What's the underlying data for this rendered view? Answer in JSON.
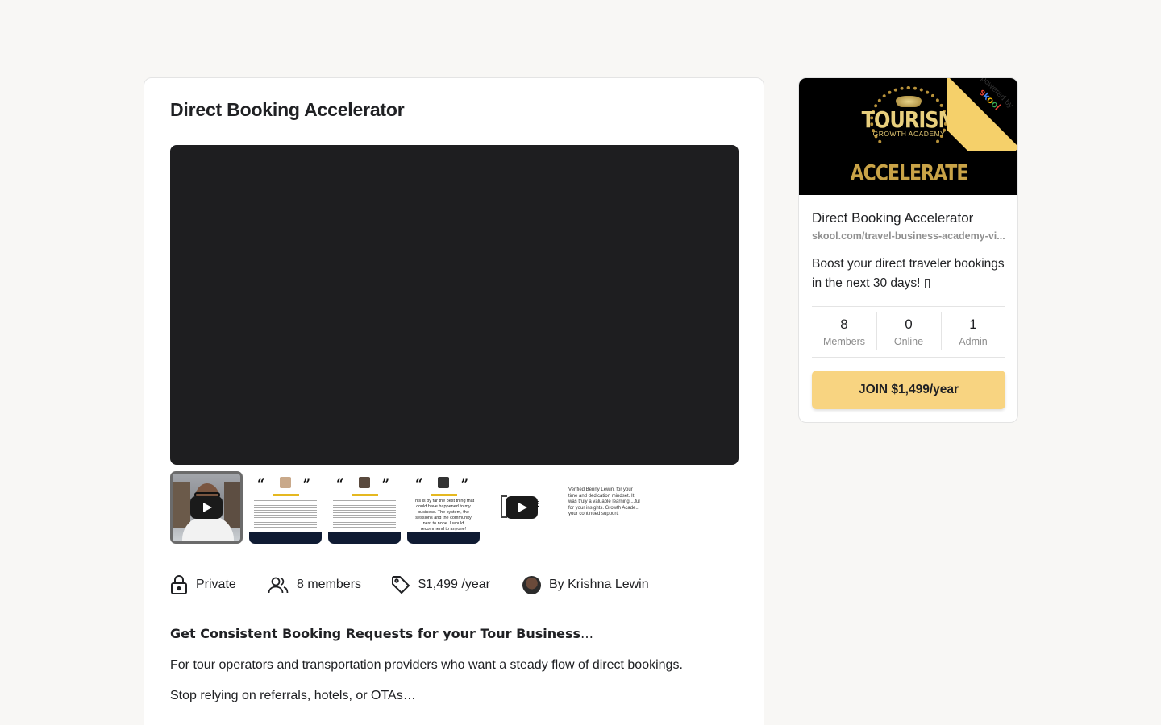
{
  "group": {
    "title": "Direct Booking Accelerator"
  },
  "gallery": {
    "thumbnails": [
      {
        "type": "video",
        "icon": "play-icon"
      },
      {
        "type": "image"
      },
      {
        "type": "image"
      },
      {
        "type": "image",
        "text": "This is by far the best thing that could have happened to my business. The system, the sessions and the community next to none. I would recommend to anyone!"
      },
      {
        "type": "video",
        "icon": "play-icon",
        "text": "GE"
      },
      {
        "type": "image",
        "text": "Verified Benny Lewin, for your time and dedication mindset. It was truly a valuable learning ...ful for your insights. Growth Acade... your continued support."
      }
    ]
  },
  "meta": {
    "privacy": "Private",
    "members": "8 members",
    "price": "$1,499 /year",
    "author": "By Krishna Lewin"
  },
  "description": {
    "heading": "Get Consistent Booking Requests for your Tour Business",
    "heading_suffix": "…",
    "paragraphs": [
      "For tour operators and transportation providers who want a steady flow of direct bookings.",
      "Stop relying on referrals, hotels, or OTAs…"
    ]
  },
  "sidebar": {
    "banner": {
      "line1": "TOURISM",
      "line2": "GROWTH ACADEMY",
      "line3": "ACCELERATE",
      "ribbon_top": "powered by",
      "ribbon_brand": "skool"
    },
    "name": "Direct Booking Accelerator",
    "url": "skool.com/travel-business-academy-vi...",
    "description": "Boost your direct traveler bookings in the next 30 days! ▯",
    "stats": [
      {
        "value": "8",
        "label": "Members"
      },
      {
        "value": "0",
        "label": "Online"
      },
      {
        "value": "1",
        "label": "Admin"
      }
    ],
    "join_label": "JOIN $1,499/year"
  },
  "colors": {
    "page_bg": "#f8f7f5",
    "video_bg": "#1e1e20",
    "join_button": "#f8d481",
    "ribbon": "#f5d06a",
    "banner_gold": "#e8cf7d"
  }
}
